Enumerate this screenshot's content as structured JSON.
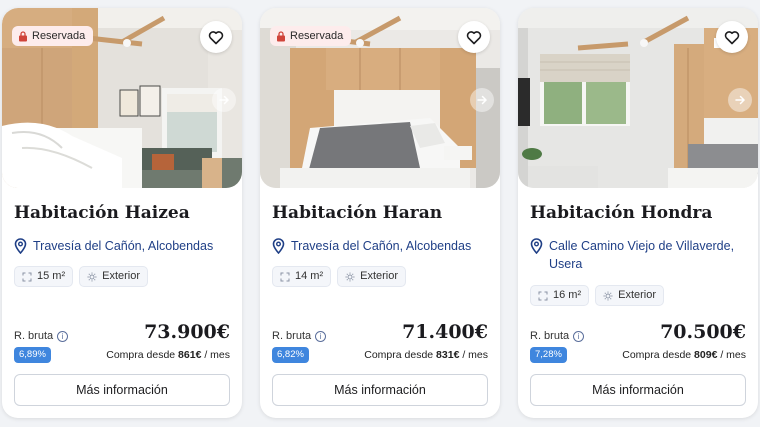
{
  "cards": [
    {
      "badge": "Reservada",
      "title": "Habitación Haizea",
      "location": "Travesía del Cañón, Alcobendas",
      "area": "15 m²",
      "orientation": "Exterior",
      "bruta_label": "R. bruta",
      "price": "73.900€",
      "yield": "6,89%",
      "compra_prefix": "Compra desde",
      "compra_amount": "861€",
      "compra_suffix": "/ mes",
      "button": "Más información"
    },
    {
      "badge": "Reservada",
      "title": "Habitación Haran",
      "location": "Travesía del Cañón, Alcobendas",
      "area": "14 m²",
      "orientation": "Exterior",
      "bruta_label": "R. bruta",
      "price": "71.400€",
      "yield": "6,82%",
      "compra_prefix": "Compra desde",
      "compra_amount": "831€",
      "compra_suffix": "/ mes",
      "button": "Más información"
    },
    {
      "badge": "",
      "title": "Habitación Hondra",
      "location": "Calle Camino Viejo de Villaverde, Usera",
      "area": "16 m²",
      "orientation": "Exterior",
      "bruta_label": "R. bruta",
      "price": "70.500€",
      "yield": "7,28%",
      "compra_prefix": "Compra desde",
      "compra_amount": "809€",
      "compra_suffix": "/ mes",
      "button": "Más información"
    }
  ],
  "icons": {
    "favorite": "heart-icon",
    "next": "arrow-right-icon",
    "location": "map-pin-icon",
    "area": "expand-icon",
    "orientation": "sun-icon",
    "info": "info-icon",
    "lock": "lock-icon"
  },
  "colors": {
    "accent_blue": "#1f3f86",
    "yield_badge": "#3f86de",
    "reserved_badge_bg": "#fdecec"
  }
}
